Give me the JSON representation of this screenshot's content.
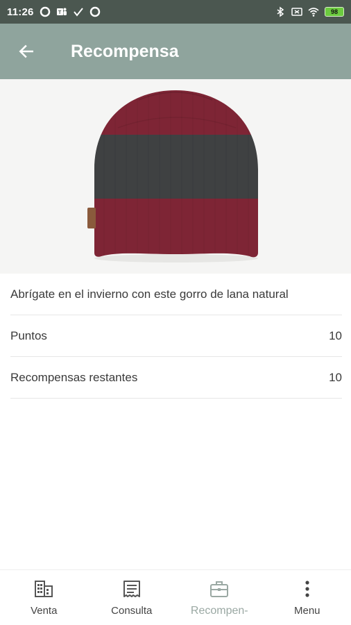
{
  "status_bar": {
    "time": "11:26",
    "battery": "98",
    "left_icons": [
      "circle-icon",
      "teams-icon",
      "check-icon",
      "circle-icon"
    ],
    "right_icons": [
      "bluetooth-icon",
      "screen-icon",
      "wifi-icon",
      "battery-icon"
    ]
  },
  "app_bar": {
    "title": "Recompensa",
    "back_icon": "arrow-left-icon",
    "color": "#8fa49d"
  },
  "product": {
    "image": "beanie-hat",
    "description": "Abrígate en el invierno con este gorro de lana natural",
    "colors": {
      "burgundy": "#7e2535",
      "gray": "#3f4142"
    }
  },
  "details": [
    {
      "label": "Puntos",
      "value": "10"
    },
    {
      "label": "Recompensas restantes",
      "value": "10"
    }
  ],
  "bottom_nav": {
    "items": [
      {
        "label": "Venta",
        "icon": "building-icon",
        "active": false
      },
      {
        "label": "Consulta",
        "icon": "receipt-icon",
        "active": false
      },
      {
        "label": "Recompen-",
        "icon": "briefcase-icon",
        "active": true
      },
      {
        "label": "Menu",
        "icon": "more-vert-icon",
        "active": false
      }
    ]
  }
}
